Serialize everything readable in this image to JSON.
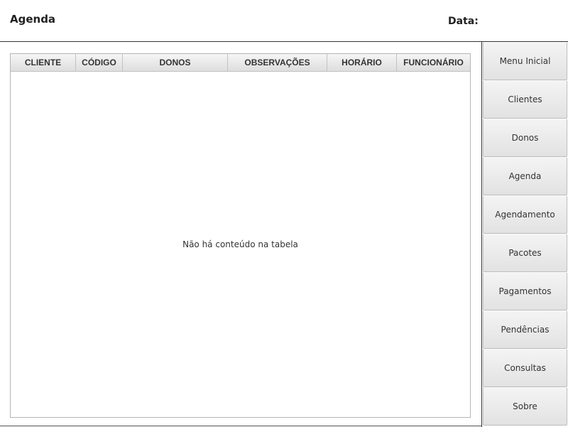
{
  "header": {
    "title": "Agenda",
    "date_label": "Data:"
  },
  "table": {
    "columns": [
      "CLIENTE",
      "CÓDIGO",
      "DONOS",
      "OBSERVAÇÕES",
      "HORÁRIO",
      "FUNCIONÁRIO"
    ],
    "empty_message": "Não há conteúdo na tabela"
  },
  "sidebar": {
    "items": [
      {
        "label": "Menu Inicial"
      },
      {
        "label": "Clientes"
      },
      {
        "label": "Donos"
      },
      {
        "label": "Agenda"
      },
      {
        "label": "Agendamento"
      },
      {
        "label": "Pacotes"
      },
      {
        "label": "Pagamentos"
      },
      {
        "label": "Pendências"
      },
      {
        "label": "Consultas"
      },
      {
        "label": "Sobre"
      }
    ]
  }
}
